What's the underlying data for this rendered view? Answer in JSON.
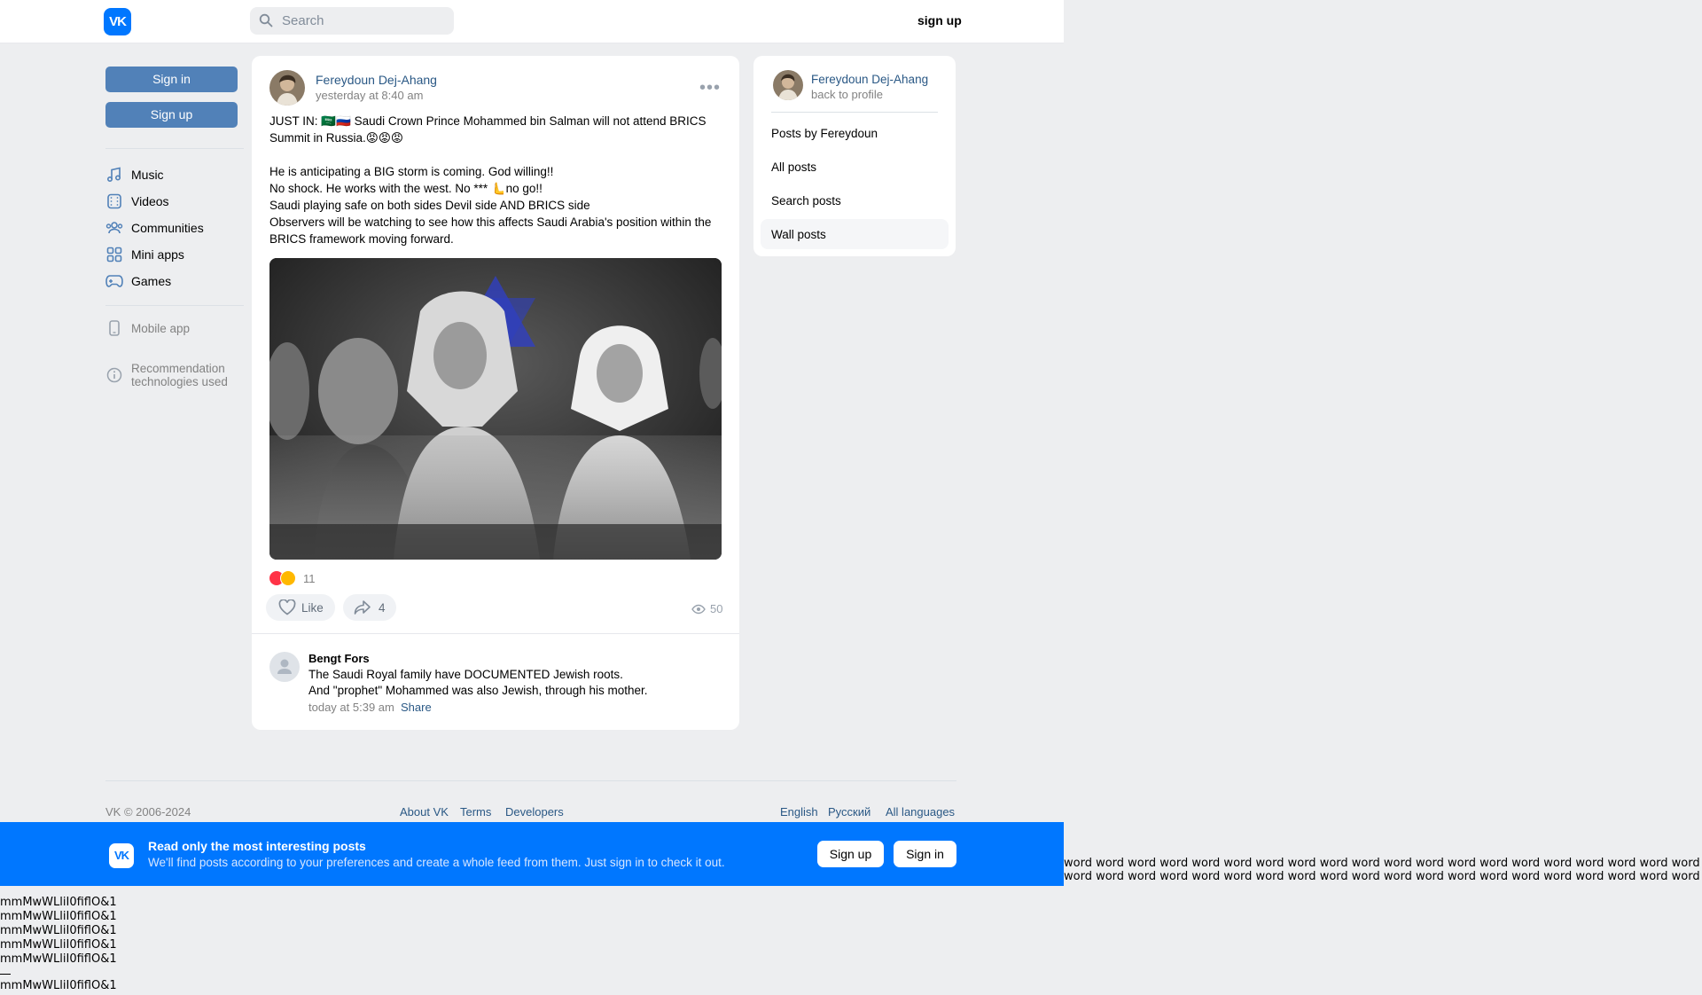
{
  "header": {
    "logo_text": "VK",
    "search_placeholder": "Search",
    "signup_label": "sign up"
  },
  "sidebar": {
    "sign_in": "Sign in",
    "sign_up": "Sign up",
    "items": [
      {
        "label": "Music",
        "icon": "music-icon"
      },
      {
        "label": "Videos",
        "icon": "videos-icon"
      },
      {
        "label": "Communities",
        "icon": "communities-icon"
      },
      {
        "label": "Mini apps",
        "icon": "mini-apps-icon"
      },
      {
        "label": "Games",
        "icon": "games-icon"
      }
    ],
    "mobile_app": "Mobile app",
    "recommendation": [
      "Recommendation",
      "technologies used"
    ]
  },
  "post": {
    "author": "Fereydoun Dej-Ahang",
    "date": "yesterday at 8:40 am",
    "more": "•••",
    "lines": [
      "JUST IN: 🇸🇦🇷🇺 Saudi Crown Prince Mohammed bin Salman will not attend BRICS",
      "Summit in Russia.😡😡😡",
      "",
      "He is anticipating a BIG storm is coming. God willing!!",
      "No shock. He works with the west. No *** 🫷no go!!",
      "Saudi playing safe on both sides Devil side AND BRICS side",
      "Observers will be watching to see how this affects Saudi Arabia's position within the",
      "BRICS framework moving forward."
    ],
    "reaction_count": "11",
    "like_label": "Like",
    "share_count": "4",
    "views": "50"
  },
  "comment": {
    "author": "Bengt Fors",
    "lines": [
      "The Saudi Royal family have DOCUMENTED Jewish roots.",
      "And \"prophet\" Mohammed was also Jewish, through his mother."
    ],
    "date": "today at 5:39 am",
    "share": "Share"
  },
  "profile_card": {
    "name": "Fereydoun Dej-Ahang",
    "back": "back to profile",
    "items": [
      "Posts by Fereydoun",
      "All posts",
      "Search posts",
      "Wall posts"
    ],
    "selected": "Wall posts"
  },
  "footer": {
    "copyright": "VK © 2006-2024",
    "links": [
      "About VK",
      "Terms",
      "Developers"
    ],
    "languages": [
      "English",
      "Русский",
      "All languages"
    ]
  },
  "banner": {
    "title": "Read only the most interesting posts",
    "subtitle": "We'll find posts according to your preferences and create a whole feed from them. Just sign in to check it out.",
    "sign_up": "Sign up",
    "sign_in": "Sign in"
  },
  "stray": {
    "words_line": "word word word word word word word word word word word word word word word word word word word word word word word word word word word word word word word word word",
    "chars_line": "mmMwWLliI0fiflO&1"
  },
  "colors": {
    "brand": "#0077ff",
    "button": "#5181b8",
    "link": "#2a5885",
    "background": "#edeef0"
  }
}
